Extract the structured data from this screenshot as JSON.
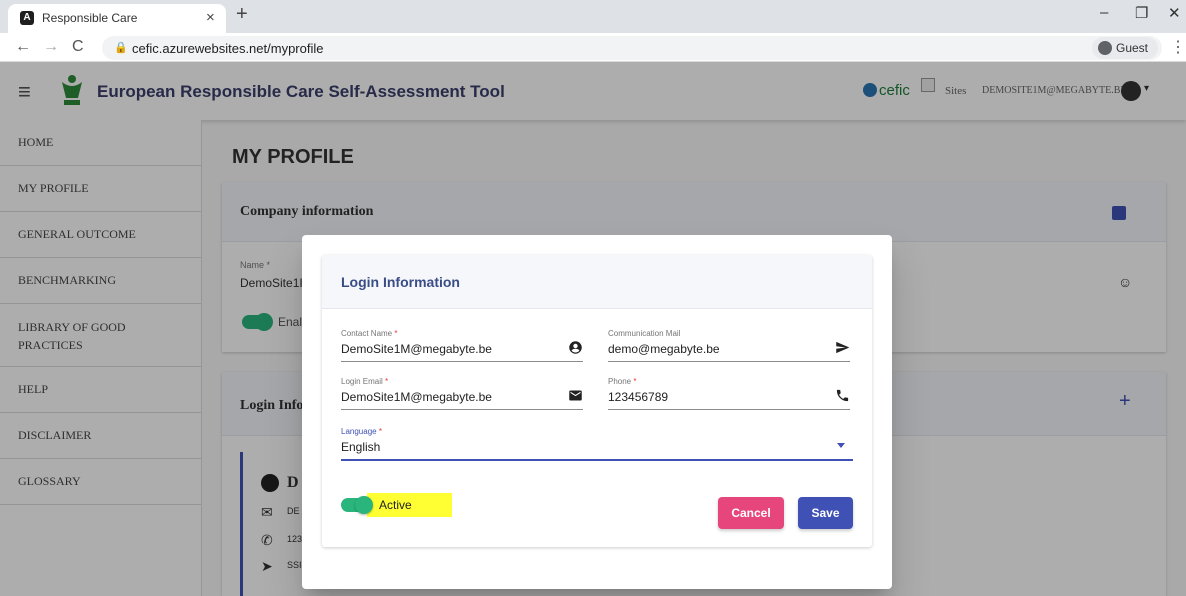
{
  "browser": {
    "tab_title": "Responsible Care",
    "tab_favicon": "A",
    "tab_close": "×",
    "new_tab": "+",
    "url": "cefic.azurewebsites.net/myprofile",
    "profile_label": "Guest",
    "controls": {
      "minimize": "–",
      "restore": "❐",
      "close": "✕",
      "back": "←",
      "forward": "→",
      "reload": "C",
      "menu": "⋮",
      "lock": "🔒"
    }
  },
  "appbar": {
    "title": "European Responsible Care Self-Assessment Tool",
    "brand": "cefic",
    "sites_label": "Sites",
    "user_email": "DEMOSITE1M@MEGABYTE.BE",
    "menu_glyph": "≡",
    "caret_glyph": "▾"
  },
  "sidebar": {
    "items": [
      {
        "label": "HOME"
      },
      {
        "label": "MY PROFILE"
      },
      {
        "label": "GENERAL OUTCOME"
      },
      {
        "label": "BENCHMARKING"
      },
      {
        "label": "LIBRARY OF GOOD PRACTICES"
      },
      {
        "label": "HELP"
      },
      {
        "label": "DISCLAIMER"
      },
      {
        "label": "GLOSSARY"
      }
    ]
  },
  "main": {
    "title": "MY PROFILE",
    "company_card": {
      "heading": "Company information",
      "name_label": "Name *",
      "name_value": "DemoSite1I",
      "toggle_label": "Enal"
    },
    "login_card": {
      "heading": "Login Info",
      "contact_initial": "D",
      "row1": "DE",
      "row2": "123",
      "row3": "SSI"
    }
  },
  "dialog": {
    "title": "Login Information",
    "fields": {
      "contact_name": {
        "label": "Contact Name",
        "required": true,
        "value": "DemoSite1M@megabyte.be",
        "icon": "account-circle-icon"
      },
      "communication_mail": {
        "label": "Communication Mail",
        "required": false,
        "value": "demo@megabyte.be",
        "icon": "send-icon"
      },
      "login_email": {
        "label": "Login Email",
        "required": true,
        "value": "DemoSite1M@megabyte.be",
        "icon": "mail-icon"
      },
      "phone": {
        "label": "Phone",
        "required": true,
        "value": "123456789",
        "icon": "phone-icon"
      },
      "language": {
        "label": "Language",
        "required": true,
        "value": "English"
      }
    },
    "active_toggle": {
      "label": "Active",
      "checked": true
    },
    "cancel_label": "Cancel",
    "save_label": "Save"
  },
  "colors": {
    "primary": "#3f51b5",
    "cancel": "#e7467c",
    "toggle_on": "#2ab57d",
    "highlight": "#ffff33"
  }
}
